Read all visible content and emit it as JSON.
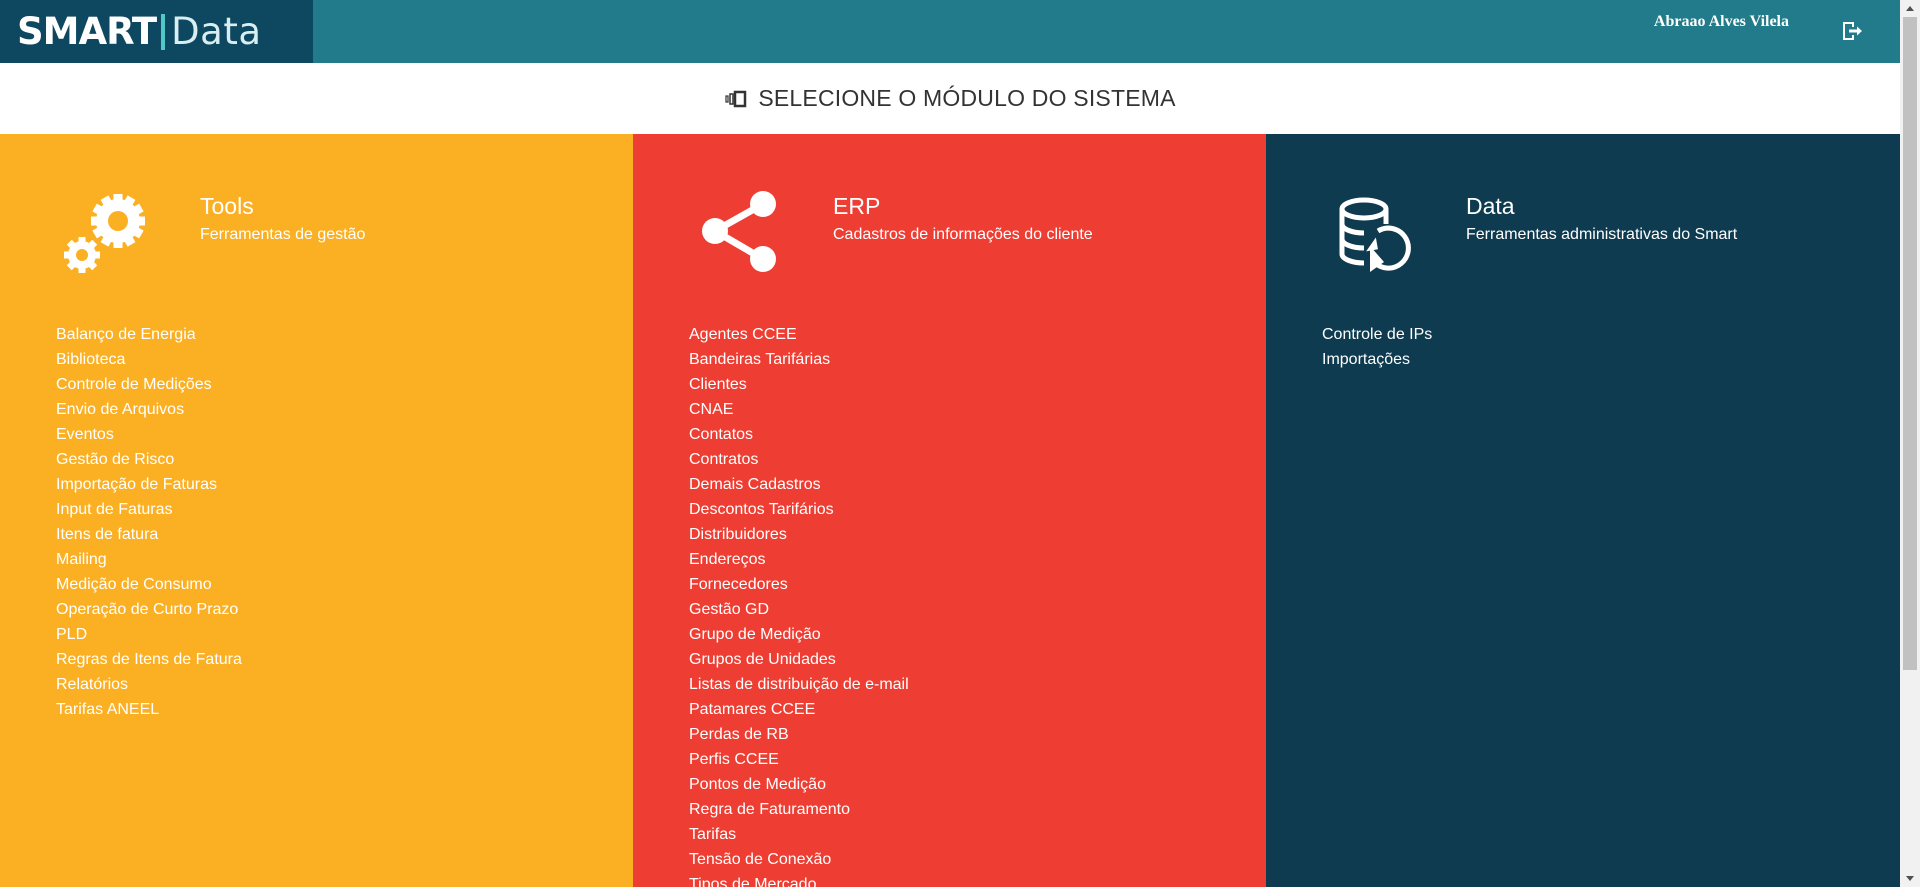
{
  "brand": {
    "logo_main": "SMART",
    "logo_sub": "Data"
  },
  "user": {
    "name": "Abraao Alves Vilela"
  },
  "header": {
    "title": "SELECIONE O MÓDULO DO SISTEMA"
  },
  "modules": [
    {
      "name": "Tools",
      "description": "Ferramentas de gestão",
      "icon": "gears-icon",
      "color": "#fbb024",
      "items": [
        "Balanço de Energia",
        "Biblioteca",
        "Controle de Medições",
        "Envio de Arquivos",
        "Eventos",
        "Gestão de Risco",
        "Importação de Faturas",
        "Input de Faturas",
        "Itens de fatura",
        "Mailing",
        "Medição de Consumo",
        "Operação de Curto Prazo",
        "PLD",
        "Regras de Itens de Fatura",
        "Relatórios",
        "Tarifas ANEEL"
      ]
    },
    {
      "name": "ERP",
      "description": "Cadastros de informações do cliente",
      "icon": "share-icon",
      "color": "#ee3e33",
      "items": [
        "Agentes CCEE",
        "Bandeiras Tarifárias",
        "Clientes",
        "CNAE",
        "Contatos",
        "Contratos",
        "Demais Cadastros",
        "Descontos Tarifários",
        "Distribuidores",
        "Endereços",
        "Fornecedores",
        "Gestão GD",
        "Grupo de Medição",
        "Grupos de Unidades",
        "Listas de distribuição de e-mail",
        "Patamares CCEE",
        "Perdas de RB",
        "Perfis CCEE",
        "Pontos de Medição",
        "Regra de Faturamento",
        "Tarifas",
        "Tensão de Conexão",
        "Tipos de Mercado"
      ]
    },
    {
      "name": "Data",
      "description": "Ferramentas administrativas do Smart",
      "icon": "database-restore-icon",
      "color": "#0e3b50",
      "items": [
        "Controle de IPs",
        "Importações"
      ]
    }
  ],
  "colors": {
    "topbar": "#217b8a",
    "logo_bg": "#0e4760"
  }
}
